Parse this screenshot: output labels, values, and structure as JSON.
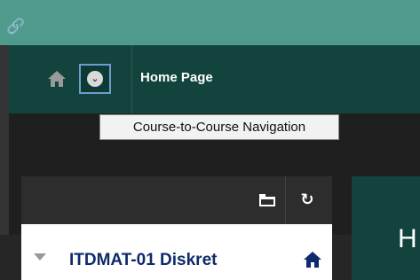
{
  "top": {
    "link_icon_glyph": "🔗"
  },
  "nav": {
    "title": "Home Page",
    "tooltip": "Course-to-Course Navigation"
  },
  "sidebar": {
    "course_title": "ITDMAT-01 Diskret"
  },
  "main": {
    "heading_initial": "H"
  },
  "colors": {
    "topbar": "#4f9a8b",
    "navbar": "#12443d",
    "course_title": "#0f2a6b"
  }
}
